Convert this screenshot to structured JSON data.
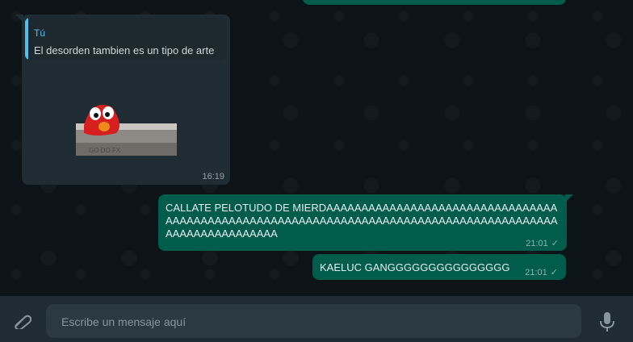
{
  "chat": {
    "incoming": {
      "quote_author": "Tú",
      "quote_text": "El desorden tambien es un tipo de arte",
      "sticker_icon": "elmo-sticker",
      "time": "16:19"
    },
    "outgoing": [
      {
        "text": "CALLATE PELOTUDO DE MIERDAAAAAAAAAAAAAAAAAAAAAAAAAAAAAAAAAAAAAAAAAAAAAAAAAAAAAAAAAAAAAAAAAAAAAAAAAAAAAAAAAAAAAAAAAAAAAAAAAAAAAAAAA",
        "time": "21:01",
        "status": "sent"
      },
      {
        "text": "KAELUC GANGGGGGGGGGGGGGGG",
        "time": "21:01",
        "status": "sent"
      }
    ]
  },
  "composer": {
    "placeholder": "Escribe un mensaje aquí",
    "attach_icon": "paperclip-icon",
    "mic_icon": "microphone-icon"
  },
  "colors": {
    "outgoing_bubble": "#005c4b",
    "incoming_bubble": "#202c33",
    "quote_accent": "#53bdeb"
  }
}
